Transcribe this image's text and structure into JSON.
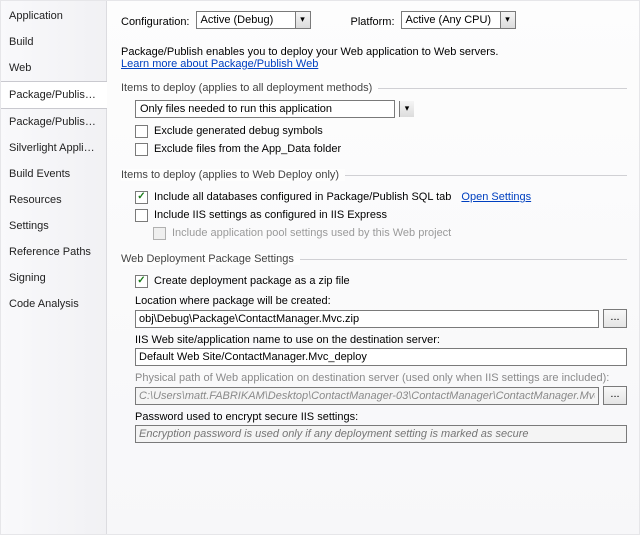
{
  "sidebar": {
    "items": [
      {
        "label": "Application"
      },
      {
        "label": "Build"
      },
      {
        "label": "Web"
      },
      {
        "label": "Package/Publish Web"
      },
      {
        "label": "Package/Publish SQL"
      },
      {
        "label": "Silverlight Applications"
      },
      {
        "label": "Build Events"
      },
      {
        "label": "Resources"
      },
      {
        "label": "Settings"
      },
      {
        "label": "Reference Paths"
      },
      {
        "label": "Signing"
      },
      {
        "label": "Code Analysis"
      }
    ],
    "selected_index": 3
  },
  "header": {
    "configuration_label": "Configuration:",
    "configuration_value": "Active (Debug)",
    "platform_label": "Platform:",
    "platform_value": "Active (Any CPU)"
  },
  "intro": {
    "text": "Package/Publish enables you to deploy your Web application to Web servers.",
    "link": "Learn more about Package/Publish Web"
  },
  "deploy_all": {
    "title": "Items to deploy (applies to all deployment methods)",
    "items_select": "Only files needed to run this application",
    "exclude_debug": {
      "label": "Exclude generated debug symbols",
      "checked": false
    },
    "exclude_appdata": {
      "label": "Exclude files from the App_Data folder",
      "checked": false
    }
  },
  "deploy_web": {
    "title": "Items to deploy (applies to Web Deploy only)",
    "include_db": {
      "label": "Include all databases configured in Package/Publish SQL tab",
      "checked": true,
      "link": "Open Settings"
    },
    "include_iis": {
      "label": "Include IIS settings as configured in IIS Express",
      "checked": false
    },
    "include_apppool": {
      "label": "Include application pool settings used by this Web project",
      "checked": false,
      "disabled": true
    }
  },
  "pkg": {
    "title": "Web Deployment Package Settings",
    "create_zip": {
      "label": "Create deployment package as a zip file",
      "checked": true
    },
    "location_label": "Location where package will be created:",
    "location_value": "obj\\Debug\\Package\\ContactManager.Mvc.zip",
    "iis_label": "IIS Web site/application name to use on the destination server:",
    "iis_value": "Default Web Site/ContactManager.Mvc_deploy",
    "phys_label": "Physical path of Web application on destination server (used only when IIS settings are included):",
    "phys_value": "C:\\Users\\matt.FABRIKAM\\Desktop\\ContactManager-03\\ContactManager\\ContactManager.Mvc_deploy",
    "pwd_label": "Password used to encrypt secure IIS settings:",
    "pwd_placeholder": "Encryption password is used only if any deployment setting is marked as secure",
    "browse": "..."
  }
}
